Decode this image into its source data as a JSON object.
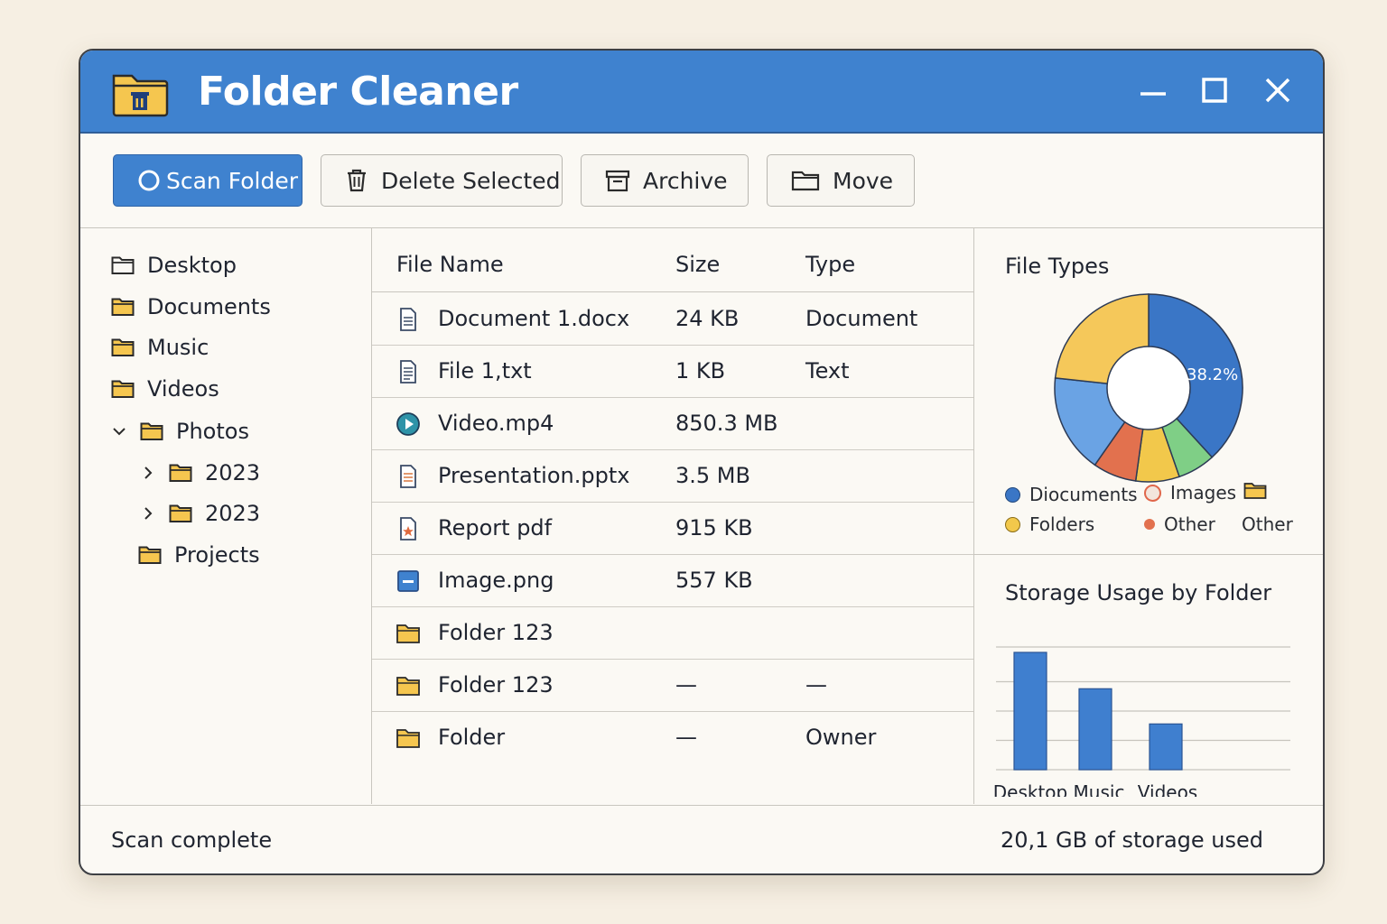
{
  "app": {
    "title": "Folder Cleaner",
    "accent": "#3f82cf"
  },
  "toolbar": {
    "scan_label": "Scan Folder",
    "delete_label": "Delete Selected",
    "archive_label": "Archive",
    "move_label": "Move"
  },
  "sidebar": {
    "items": [
      {
        "label": "Desktop",
        "icon": "folder-outline-icon"
      },
      {
        "label": "Documents",
        "icon": "folder-icon"
      },
      {
        "label": "Music",
        "icon": "folder-icon"
      },
      {
        "label": "Videos",
        "icon": "folder-icon"
      },
      {
        "label": "Photos",
        "icon": "folder-icon",
        "expanded": true
      },
      {
        "label": "2023",
        "icon": "folder-icon",
        "expanded": false
      },
      {
        "label": "2023",
        "icon": "folder-icon",
        "expanded": false
      },
      {
        "label": "Projects",
        "icon": "folder-icon"
      }
    ]
  },
  "filelist": {
    "columns": [
      "File Name",
      "Size",
      "Type"
    ],
    "rows": [
      {
        "name": "Document 1.docx",
        "size": "24 KB",
        "type": "Document",
        "icon": "document-icon"
      },
      {
        "name": "File 1,txt",
        "size": "1 KB",
        "type": "Text",
        "icon": "text-file-icon"
      },
      {
        "name": "Video.mp4",
        "size": "850.3 MB",
        "type": "",
        "icon": "video-icon"
      },
      {
        "name": "Presentation.pptx",
        "size": "3.5 MB",
        "type": "",
        "icon": "presentation-icon"
      },
      {
        "name": "Report pdf",
        "size": "915 KB",
        "type": "",
        "icon": "pdf-icon"
      },
      {
        "name": "Image.png",
        "size": "557 KB",
        "type": "",
        "icon": "image-icon"
      },
      {
        "name": "Folder 123",
        "size": "",
        "type": "",
        "icon": "folder-icon"
      },
      {
        "name": "Folder 123",
        "size": "—",
        "type": "—",
        "icon": "folder-icon"
      },
      {
        "name": "Folder",
        "size": "—",
        "type": "Owner",
        "icon": "folder-icon"
      }
    ]
  },
  "file_types": {
    "title": "File Types",
    "center_label": "38.2%",
    "legend": [
      {
        "label": "Diocuments",
        "color": "#3a76c6"
      },
      {
        "label": "Images",
        "color": "#e0664a",
        "hollow": true
      },
      {
        "label": "Folders",
        "color": "#f2c84b"
      },
      {
        "label": "Other",
        "color": "#e2714e"
      },
      {
        "label": "Other",
        "color": "#f2c84b",
        "icon": "folder-icon"
      }
    ]
  },
  "storage": {
    "title": "Storage Usage by Folder"
  },
  "chart_data": [
    {
      "type": "pie",
      "title": "File Types",
      "series": [
        {
          "name": "Documents",
          "value": 38.2,
          "color": "#3a76c6"
        },
        {
          "name": "Images",
          "value": 6.5,
          "color": "#7fcf86"
        },
        {
          "name": "Folders",
          "value": 7.5,
          "color": "#f2c84b"
        },
        {
          "name": "Other",
          "value": 7.5,
          "color": "#e2714e"
        },
        {
          "name": "Other",
          "value": 17.0,
          "color": "#6aa3e4"
        },
        {
          "name": "Folders",
          "value": 23.3,
          "color": "#f5c85a"
        }
      ]
    },
    {
      "type": "bar",
      "title": "Storage Usage by Folder",
      "categories": [
        "Desktop",
        "Music",
        "Videos"
      ],
      "values": [
        100,
        69,
        39
      ],
      "ylim": [
        0,
        100
      ],
      "grid": true
    }
  ],
  "status": {
    "left": "Scan complete",
    "right": "20,1 GB of storage used"
  }
}
